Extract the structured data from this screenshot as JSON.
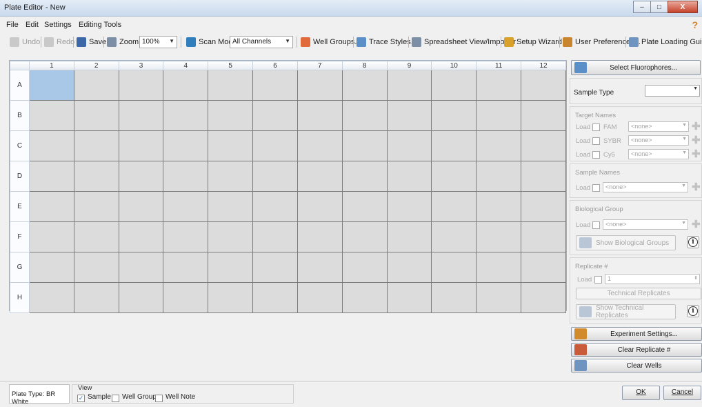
{
  "window": {
    "title": "Plate Editor - New",
    "minimize": "–",
    "maximize": "□",
    "close": "X"
  },
  "menu": {
    "file": "File",
    "edit": "Edit",
    "settings": "Settings",
    "editing_tools": "Editing Tools",
    "help": "?"
  },
  "toolbar": {
    "undo": "Undo",
    "redo": "Redo",
    "save": "Save",
    "zoom": "Zoom",
    "zoom_value": "100%",
    "scan_mode": "Scan Mode",
    "scan_mode_value": "All Channels",
    "well_groups": "Well Groups...",
    "trace_styles": "Trace Styles...",
    "spreadsheet": "Spreadsheet View/Importer",
    "setup_wizard": "Setup Wizard...",
    "user_prefs": "User Preferences...",
    "plate_guide": "Plate Loading Guide"
  },
  "plate": {
    "columns": [
      "1",
      "2",
      "3",
      "4",
      "5",
      "6",
      "7",
      "8",
      "9",
      "10",
      "11",
      "12"
    ],
    "rows": [
      "A",
      "B",
      "C",
      "D",
      "E",
      "F",
      "G",
      "H"
    ],
    "selected_well": "A1"
  },
  "panel": {
    "select_fluorophores": "Select Fluorophores...",
    "sample_type_label": "Sample Type",
    "sample_type_value": "",
    "target_names_title": "Target Names",
    "load": "Load",
    "targets": [
      {
        "fluor": "FAM",
        "value": "<none>"
      },
      {
        "fluor": "SYBR",
        "value": "<none>"
      },
      {
        "fluor": "Cy5",
        "value": "<none>"
      }
    ],
    "sample_names_title": "Sample Names",
    "sample_names_value": "<none>",
    "bio_group_title": "Biological Group",
    "bio_group_value": "<none>",
    "show_bio_groups": "Show Biological Groups",
    "replicate_title": "Replicate #",
    "replicate_value": "1",
    "technical_replicates": "Technical Replicates",
    "show_tech_replicates": "Show Technical Replicates",
    "experiment_settings": "Experiment Settings...",
    "clear_replicate": "Clear Replicate #",
    "clear_wells": "Clear Wells"
  },
  "footer": {
    "plate_type": "Plate Type: BR White",
    "view_label": "View",
    "view_sample": "Sample",
    "view_sample_checked": true,
    "view_well_group": "Well Group",
    "view_well_note": "Well Note",
    "ok": "OK",
    "cancel": "Cancel"
  }
}
